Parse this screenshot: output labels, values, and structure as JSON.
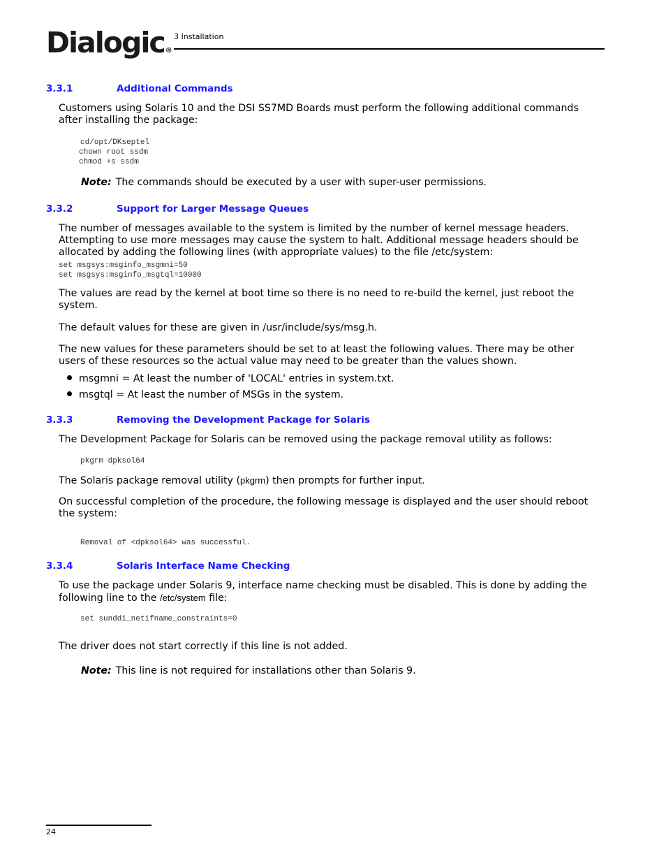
{
  "header": {
    "logo_text": "Dialogic",
    "logo_mark": "®",
    "chapter": "3 Installation"
  },
  "sections": [
    {
      "number": "3.3.1",
      "title": "Additional Commands",
      "intro": "Customers using Solaris 10 and the DSI SS7MD Boards must perform the following additional commands after installing the package:",
      "code": [
        "cd/opt/DKseptel",
        "chown root ssdm",
        "chmod +s ssdm"
      ],
      "note_label": "Note:",
      "note_text": "The commands should be executed by a user with super-user permissions."
    },
    {
      "number": "3.3.2",
      "title": "Support for Larger Message Queues",
      "intro": "The number of messages available to the system is limited by the number of kernel message headers. Attempting to use more messages may cause the system to halt. Additional message headers should be allocated by adding the following lines (with appropriate values) to the file /etc/system:",
      "code": [
        "set msgsys:msginfo_msgmni=50",
        "set msgsys:msginfo_msgtql=10000"
      ],
      "para2": "The values are read by the kernel at boot time so there is no need to re-build the kernel, just reboot the system.",
      "para3": "The default values for these are given in /usr/include/sys/msg.h.",
      "para4": "The new values for these parameters should be set to at least the following values. There may be other users of these resources so the actual value may need to be greater than the values shown.",
      "bullets": [
        "msgmni = At least the number of 'LOCAL' entries in system.txt.",
        "msgtql = At least the number of MSGs in the system."
      ]
    },
    {
      "number": "3.3.3",
      "title": "Removing the Development Package for Solaris",
      "intro": "The Development Package for Solaris can be removed using the package removal utility as follows:",
      "code": [
        "pkgrm dpksol64"
      ],
      "para2_before": "The Solaris package removal utility (",
      "para2_code": "pkgrm",
      "para2_after": ") then prompts for further input.",
      "para3": "On successful completion of the procedure, the following message is displayed and the user should reboot the system:",
      "code2": [
        "Removal of <dpksol64> was successful."
      ]
    },
    {
      "number": "3.3.4",
      "title": "Solaris Interface Name Checking",
      "intro_before": "To use the package under Solaris 9, interface name checking must be disabled. This is done by adding the following line to the ",
      "intro_code": "/etc/system",
      "intro_after": " file:",
      "code": [
        "set sunddi_netifname_constraints=0"
      ],
      "para2": "The driver does not start correctly if this line is not added.",
      "note_label": "Note:",
      "note_text": "This line is not required for installations other than Solaris 9."
    }
  ],
  "footer": {
    "page_number": "24"
  }
}
